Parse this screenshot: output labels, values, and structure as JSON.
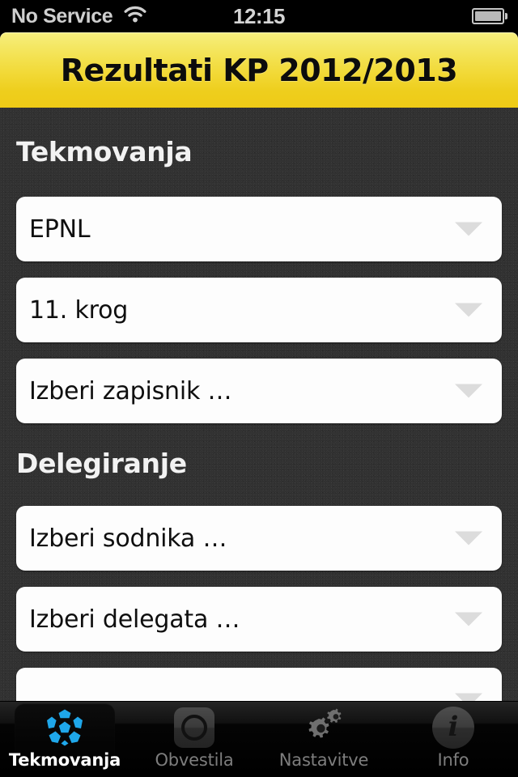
{
  "status_bar": {
    "carrier": "No Service",
    "time": "12:15",
    "wifi_icon": "wifi-icon",
    "battery_icon": "battery-full-icon"
  },
  "nav_bar": {
    "title": "Rezultati KP 2012/2013",
    "accent_top": "#f6ef7e",
    "accent_bottom": "#eecb16"
  },
  "content": {
    "background_color": "#323232",
    "sections": [
      {
        "header": "Tekmovanja",
        "fields": [
          {
            "value": "EPNL",
            "arrow_icon": "chevron-down-icon"
          },
          {
            "value": "11. krog",
            "arrow_icon": "chevron-down-icon"
          },
          {
            "value": "Izberi zapisnik …",
            "arrow_icon": "chevron-down-icon"
          }
        ]
      },
      {
        "header": "Delegiranje",
        "fields": [
          {
            "value": "Izberi sodnika …",
            "arrow_icon": "chevron-down-icon"
          },
          {
            "value": "Izberi delegata …",
            "arrow_icon": "chevron-down-icon"
          },
          {
            "value": "",
            "arrow_icon": "chevron-down-icon"
          }
        ]
      }
    ]
  },
  "tab_bar": {
    "active_index": 0,
    "tabs": [
      {
        "label": "Tekmovanja",
        "icon": "soccer-ball-icon",
        "accent": "#1fa7ea"
      },
      {
        "label": "Obvestila",
        "icon": "notification-circle-icon"
      },
      {
        "label": "Nastavitve",
        "icon": "gears-icon"
      },
      {
        "label": "Info",
        "icon": "info-circle-icon"
      }
    ]
  }
}
